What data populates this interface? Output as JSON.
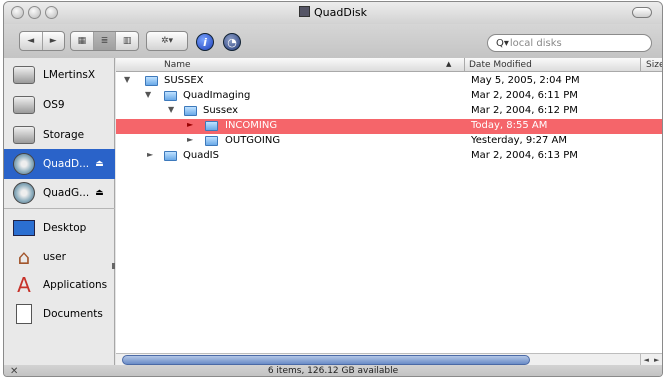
{
  "window": {
    "title": "QuadDisk"
  },
  "toolbar": {
    "nav_back": "◄",
    "nav_forward": "►",
    "view_icon": "▦",
    "view_list": "≣",
    "view_columns": "▥",
    "action_label": "✲▾",
    "info_label": "i",
    "burn_label": "◔",
    "search_icon_glyph": "Q▾",
    "search_placeholder": "local disks"
  },
  "sidebar": {
    "devices": [
      {
        "label": "LMertinsX",
        "icon": "hard-drive-icon"
      },
      {
        "label": "OS9",
        "icon": "hard-drive-icon"
      },
      {
        "label": "Storage",
        "icon": "hard-drive-icon"
      },
      {
        "label": "QuadD...",
        "icon": "network-disk-icon",
        "eject": "⏏",
        "selected": true
      },
      {
        "label": "QuadG...",
        "icon": "disk-icon",
        "eject": "⏏"
      }
    ],
    "places": [
      {
        "label": "Desktop",
        "icon": "desktop-icon"
      },
      {
        "label": "user",
        "icon": "home-icon"
      },
      {
        "label": "Applications",
        "icon": "applications-icon"
      },
      {
        "label": "Documents",
        "icon": "documents-icon"
      }
    ]
  },
  "list": {
    "columns": {
      "name": "Name",
      "date": "Date Modified",
      "size": "Size"
    },
    "sort_indicator": "▲",
    "rows": [
      {
        "name": "SUSSEX",
        "date": "May 5, 2005, 2:04 PM",
        "level": 0,
        "expanded": true
      },
      {
        "name": "QuadImaging",
        "date": "Mar 2, 2004, 6:11 PM",
        "level": 1,
        "expanded": true
      },
      {
        "name": "Sussex",
        "date": "Mar 2, 2004, 6:12 PM",
        "level": 2,
        "expanded": true
      },
      {
        "name": "INCOMING",
        "date": "Today, 8:55 AM",
        "level": 3,
        "expanded": false,
        "selected": true
      },
      {
        "name": "OUTGOING",
        "date": "Yesterday, 9:27 AM",
        "level": 3,
        "expanded": false
      },
      {
        "name": "QuadIS",
        "date": "Mar 2, 2004, 6:13 PM",
        "level": 1,
        "expanded": false
      }
    ]
  },
  "scrollbar": {
    "left_arrow": "◄",
    "right_arrow": "►"
  },
  "status": {
    "text": "6 items, 126.12 GB available",
    "tool_glyph": "✕"
  },
  "colors": {
    "selection_sidebar": "#2a63c9",
    "selection_row": "#f5656a"
  }
}
